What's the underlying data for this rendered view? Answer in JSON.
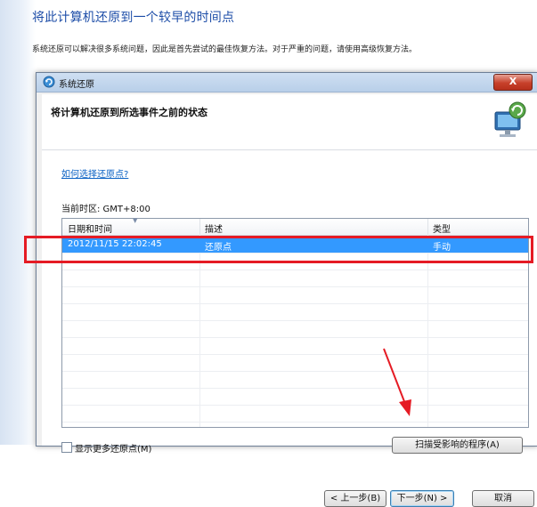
{
  "page": {
    "title": "将此计算机还原到一个较早的时间点",
    "description": "系统还原可以解决很多系统问题，因此是首先尝试的最佳恢复方法。对于严重的问题，请使用高级恢复方法。"
  },
  "dialog": {
    "window_title": "系统还原",
    "close_label": "X",
    "heading": "将计算机还原到所选事件之前的状态",
    "help_link": "如何选择还原点?",
    "timezone": "当前时区: GMT+8:00",
    "table": {
      "columns": [
        "日期和时间",
        "描述",
        "类型"
      ],
      "rows": [
        {
          "datetime": "2012/11/15 22:02:45",
          "description": "还原点",
          "type": "手动",
          "selected": true
        }
      ]
    },
    "show_more_label": "显示更多还原点(M)",
    "scan_button": "扫描受影响的程序(A)",
    "prev_button": "< 上一步(B)",
    "next_button": "下一步(N) >",
    "cancel_button": "取消"
  },
  "colors": {
    "selection": "#3399ff",
    "annotation": "#e51b24",
    "title": "#1e4ea8"
  }
}
